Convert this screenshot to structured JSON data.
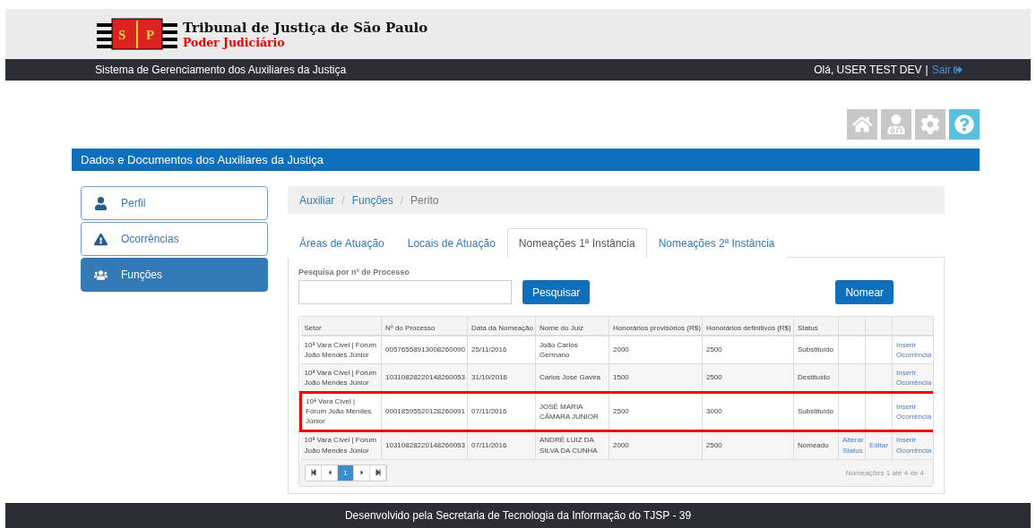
{
  "header": {
    "logo_left": "S",
    "logo_right": "P",
    "title": "Tribunal de Justiça de São Paulo",
    "subtitle": "Poder Judiciário"
  },
  "nav_bar": {
    "system_name": "Sistema de Gerenciamento dos Auxiliares da Justiça",
    "greeting": "Olá, USER TEST DEV",
    "separator": "|",
    "logout": "Sair"
  },
  "toolbar": [
    {
      "kind": "home",
      "selected": false
    },
    {
      "kind": "user",
      "selected": false
    },
    {
      "kind": "settings",
      "selected": false
    },
    {
      "kind": "help",
      "selected": true
    }
  ],
  "section_title": "Dados e Documentos dos Auxiliares da Justiça",
  "sidebar": {
    "items": [
      {
        "kind": "profile",
        "label": "Perfil",
        "selected": false
      },
      {
        "kind": "warning",
        "label": "Ocorrências",
        "selected": false
      },
      {
        "kind": "group",
        "label": "Funções",
        "selected": true
      }
    ]
  },
  "breadcrumb": [
    "Auxiliar",
    "Funções",
    "Perito"
  ],
  "breadcrumb_separator": "/",
  "tabs": [
    {
      "label": "Áreas de Atuação",
      "selected": false
    },
    {
      "label": "Locais de Atuação",
      "selected": false
    },
    {
      "label": "Nomeações 1ª Instância",
      "selected": true
    },
    {
      "label": "Nomeações 2ª Instância",
      "selected": false
    }
  ],
  "search": {
    "label": "Pesquisa por nº de Processo",
    "button": "Pesquisar"
  },
  "primary_button": "Nomear",
  "table": {
    "columns": [
      "Setor",
      "Nº do Processo",
      "Data da Nomeação",
      "Nome do Juiz",
      "Honorários provisórios (R$)",
      "Honorários definitivos (R$)",
      "Status"
    ],
    "rows": [
      {
        "highlighted": false,
        "cells": [
          "10ª Vara Cível | Fórum João Mendes Júnior",
          "00576558913008260090",
          "25/11/2016",
          "João Carlos Germano",
          "2000",
          "2500",
          "Substituído"
        ],
        "action_3": "Inserir Ocorrência"
      },
      {
        "highlighted": false,
        "cells": [
          "10ª Vara Cível | Fórum João Mendes Júnior",
          "10310828220148260053",
          "31/10/2016",
          "Carlos José Gavira",
          "1500",
          "2500",
          "Destituído"
        ],
        "action_3": "Inserir Ocorrência"
      },
      {
        "highlighted": true,
        "cells": [
          "10ª Vara Cível | Fórum João Mendes Júnior",
          "00018595520128260091",
          "07/11/2016",
          "JOSÉ MARIA CÂMARA JUNIOR",
          "2500",
          "3000",
          "Substituído"
        ],
        "action_3": "Inserir Ocorrência"
      },
      {
        "highlighted": false,
        "cells": [
          "10ª Vara Cível | Fórum João Mendes Júnior",
          "10310828220148260053",
          "07/11/2016",
          "ANDRÉ LUIZ DA SILVA DA CUNHA",
          "2000",
          "2500",
          "Nomeado"
        ],
        "action_1": "Alterar Status",
        "action_2": "Editar",
        "action_3": "Inserir Ocorrência"
      }
    ]
  },
  "pagination": {
    "pages": [
      {
        "label": "1",
        "selected": true
      }
    ],
    "summary": "Nomeações 1 até 4 de 4"
  },
  "footer": "Desenvolvido pela Secretaria de Tecnologia da Informação do TJSP - 39"
}
